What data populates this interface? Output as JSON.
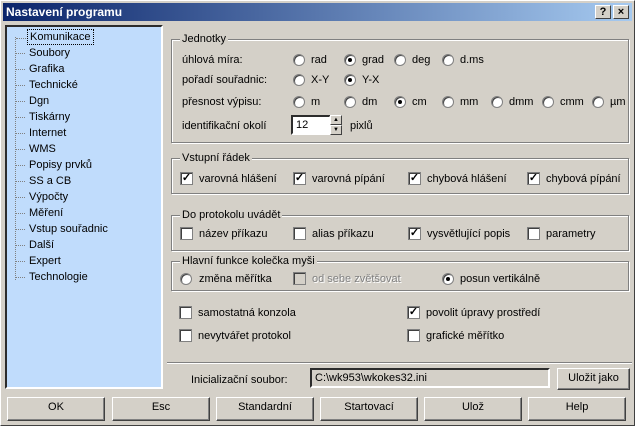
{
  "window": {
    "title": "Nastavení programu",
    "help_label": "?",
    "close_label": "×"
  },
  "sidebar": {
    "items": [
      {
        "label": "Komunikace",
        "selected": true
      },
      {
        "label": "Soubory"
      },
      {
        "label": "Grafika"
      },
      {
        "label": "Technické"
      },
      {
        "label": "Dgn"
      },
      {
        "label": "Tiskárny"
      },
      {
        "label": "Internet"
      },
      {
        "label": "WMS"
      },
      {
        "label": "Popisy prvků"
      },
      {
        "label": "SS a CB"
      },
      {
        "label": "Výpočty"
      },
      {
        "label": "Měření"
      },
      {
        "label": "Vstup souřadnic"
      },
      {
        "label": "Další"
      },
      {
        "label": "Expert"
      },
      {
        "label": "Technologie"
      }
    ]
  },
  "units": {
    "title": "Jednotky",
    "angle": {
      "label": "úhlová míra:",
      "options": [
        "rad",
        "grad",
        "deg",
        "d.ms"
      ],
      "selected": "grad"
    },
    "coord_order": {
      "label": "pořadí souřadnic:",
      "options": [
        "X-Y",
        "Y-X"
      ],
      "selected": "Y-X"
    },
    "precision": {
      "label": "přesnost výpisu:",
      "options": [
        "m",
        "dm",
        "cm",
        "mm",
        "dmm",
        "cmm",
        "µm"
      ],
      "selected": "cm"
    },
    "ident": {
      "label": "identifikační okolí",
      "value": "12",
      "unit": "pixlů"
    }
  },
  "input_line": {
    "title": "Vstupní řádek",
    "options": [
      {
        "label": "varovná hlášení",
        "checked": true
      },
      {
        "label": "varovná pípání",
        "checked": true
      },
      {
        "label": "chybová hlášení",
        "checked": true
      },
      {
        "label": "chybová pípání",
        "checked": true
      }
    ]
  },
  "protocol": {
    "title": "Do protokolu uvádět",
    "options": [
      {
        "label": "název příkazu",
        "checked": false
      },
      {
        "label": "alias příkazu",
        "checked": false
      },
      {
        "label": "vysvětlující popis",
        "checked": true
      },
      {
        "label": "parametry",
        "checked": false
      }
    ]
  },
  "wheel": {
    "title": "Hlavní funkce kolečka myši",
    "zoom": {
      "label": "změna měřítka",
      "checked": false
    },
    "spread": {
      "label": "od sebe zvětšovat",
      "checked": false,
      "disabled": true
    },
    "scroll": {
      "label": "posun vertikálně",
      "checked": true
    }
  },
  "misc": {
    "console": {
      "label": "samostatná konzola",
      "checked": false
    },
    "no_protocol": {
      "label": "nevytvářet protokol",
      "checked": false
    },
    "allow_env": {
      "label": "povolit úpravy prostředí",
      "checked": true
    },
    "graphic_scale": {
      "label": "grafické měřítko",
      "checked": false
    }
  },
  "init_file": {
    "label": "Inicializační soubor:",
    "value": "C:\\wk953\\wkokes32.ini",
    "save_label": "Uložit jako"
  },
  "buttons": {
    "ok": "OK",
    "esc": "Esc",
    "standard": "Standardní",
    "startup": "Startovací",
    "save": "Ulož",
    "help": "Help"
  }
}
